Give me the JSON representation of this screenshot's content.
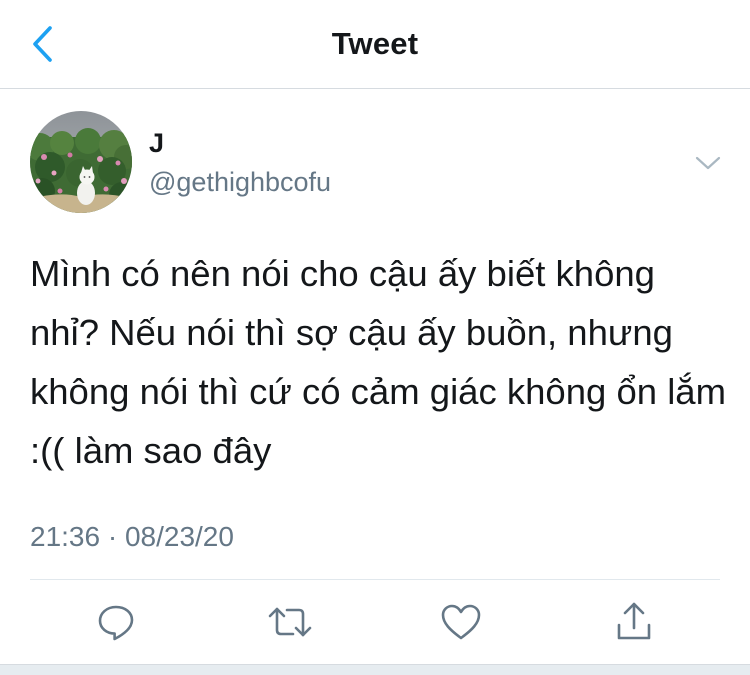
{
  "header": {
    "title": "Tweet",
    "back_icon": "chevron-left-icon"
  },
  "tweet": {
    "display_name": "J",
    "handle": "@gethighbcofu",
    "text": "Mình có nên nói cho cậu ấy biết không nhỉ? Nếu nói thì sợ cậu ấy buồn, nhưng không nói thì cứ có cảm giác không ổn lắm :(( làm sao đây",
    "timestamp": "21:36 · 08/23/20"
  },
  "actions": [
    {
      "name": "reply",
      "icon": "speech-bubble-icon"
    },
    {
      "name": "retweet",
      "icon": "retweet-icon"
    },
    {
      "name": "like",
      "icon": "heart-icon"
    },
    {
      "name": "share",
      "icon": "share-icon"
    }
  ],
  "colors": {
    "accent": "#1da1f2",
    "text_primary": "#14171a",
    "text_secondary": "#657786",
    "icon": "#657786",
    "divider": "#e1e8ed"
  }
}
